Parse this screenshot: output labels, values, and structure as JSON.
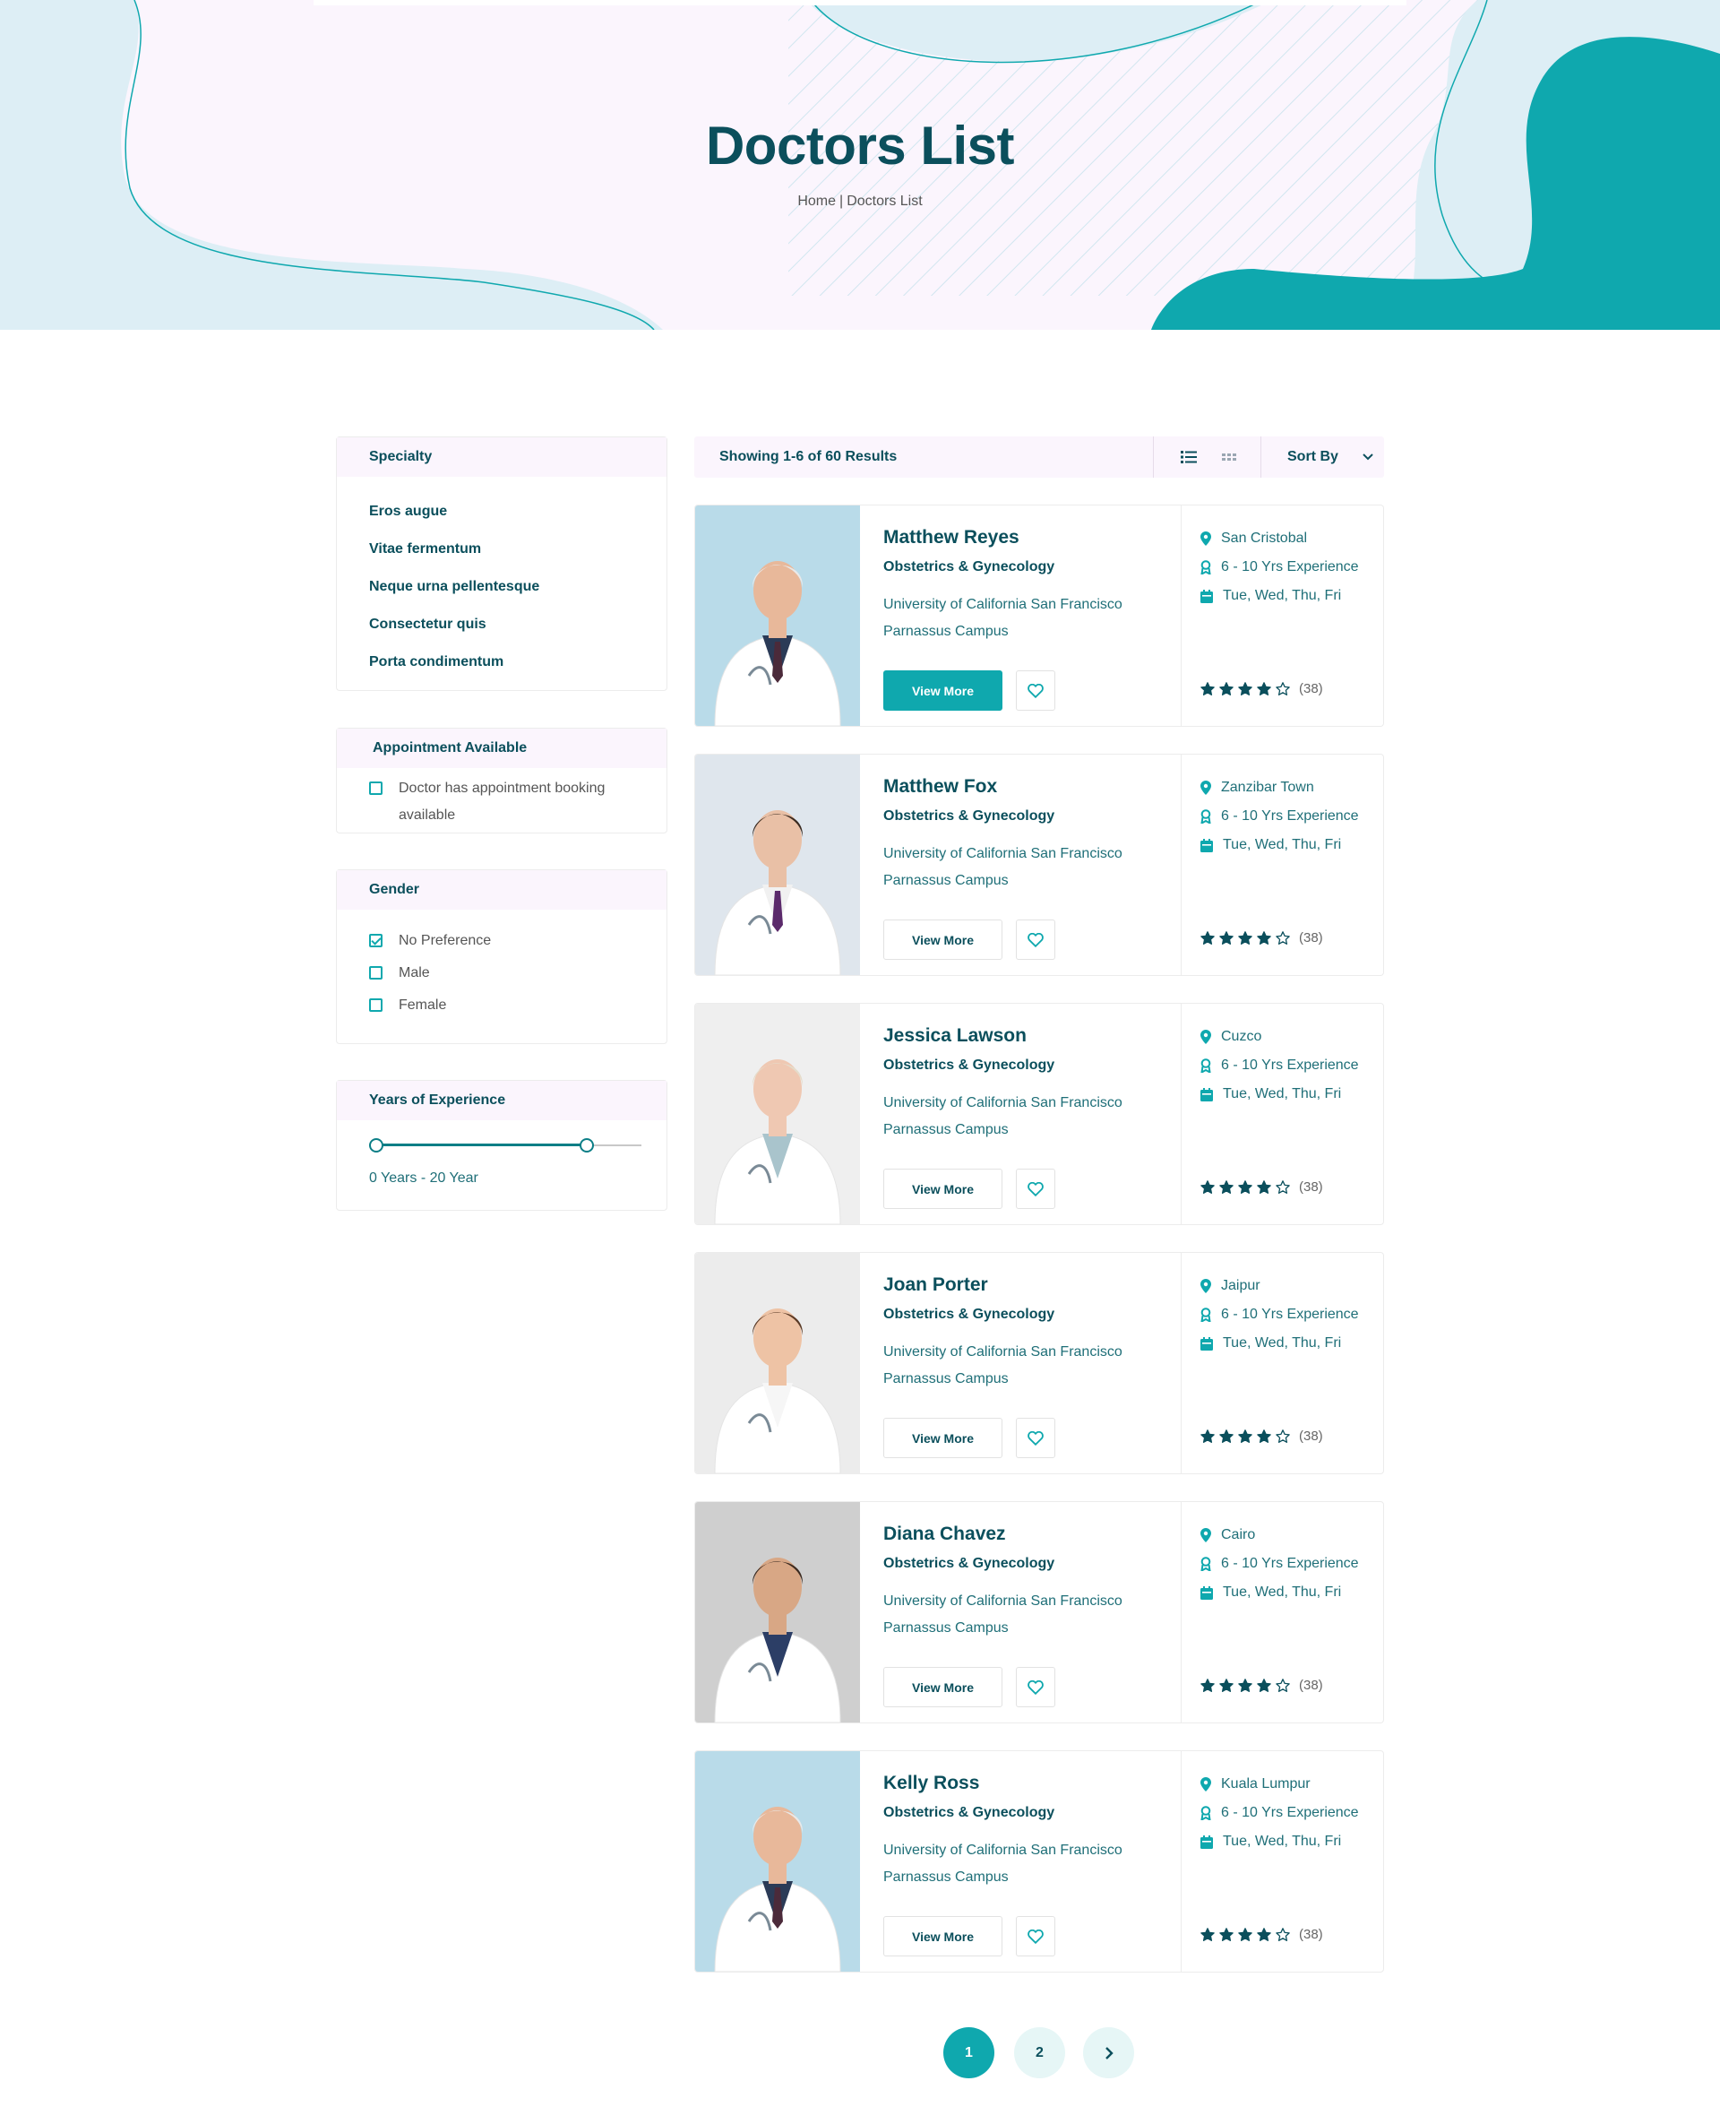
{
  "page": {
    "title": "Doctors List",
    "breadcrumb": {
      "home": "Home",
      "separator": "|",
      "current": "Doctors List"
    }
  },
  "colors": {
    "accent": "#0fa8ae",
    "dark": "#0b4f5c",
    "hero_bg": "#fbf5fd",
    "blob": "#ddeef5"
  },
  "sidebar": {
    "specialty": {
      "title": "Specialty",
      "items": [
        "Eros augue",
        "Vitae fermentum",
        "Neque urna pellentesque",
        "Consectetur quis",
        "Porta condimentum"
      ]
    },
    "appointment": {
      "title": "Appointment Available",
      "option": "Doctor has appointment booking available",
      "checked": false
    },
    "gender": {
      "title": "Gender",
      "options": [
        {
          "label": "No Preference",
          "checked": true
        },
        {
          "label": "Male",
          "checked": false
        },
        {
          "label": "Female",
          "checked": false
        }
      ]
    },
    "experience": {
      "title": "Years of Experience",
      "range_label": "0 Years - 20 Year",
      "slider_min_fraction": 0.0,
      "slider_max_fraction": 0.8
    }
  },
  "results": {
    "count_text": "Showing 1-6 of 60 Results",
    "view_icons": [
      "list-view-icon",
      "grid-view-icon"
    ],
    "sort_label": "Sort By"
  },
  "doctors": [
    {
      "name": "Matthew Reyes",
      "specialty": "Obstetrics & Gynecology",
      "university": "University of California San Francisco Parnassus Campus",
      "location": "San Cristobal",
      "experience": "6 - 10 Yrs Experience",
      "days": "Tue, Wed, Thu, Fri",
      "rating": 4,
      "reviews": "(38)",
      "button": "View More",
      "photo": "senior-male-doctor-ok-gesture"
    },
    {
      "name": "Matthew Fox",
      "specialty": "Obstetrics & Gynecology",
      "university": "University of California San Francisco Parnassus Campus",
      "location": "Zanzibar Town",
      "experience": "6 - 10 Yrs Experience",
      "days": "Tue, Wed, Thu, Fri",
      "rating": 4,
      "reviews": "(38)",
      "button": "View More",
      "photo": "female-doctor-with-tablet"
    },
    {
      "name": "Jessica Lawson",
      "specialty": "Obstetrics & Gynecology",
      "university": "University of California San Francisco Parnassus Campus",
      "location": "Cuzco",
      "experience": "6 - 10 Yrs Experience",
      "days": "Tue, Wed, Thu, Fri",
      "rating": 4,
      "reviews": "(38)",
      "button": "View More",
      "photo": "senior-female-doctor-arms-crossed"
    },
    {
      "name": "Joan Porter",
      "specialty": "Obstetrics & Gynecology",
      "university": "University of California San Francisco Parnassus Campus",
      "location": "Jaipur",
      "experience": "6 - 10 Yrs Experience",
      "days": "Tue, Wed, Thu, Fri",
      "rating": 4,
      "reviews": "(38)",
      "button": "View More",
      "photo": "female-doctor-pointing"
    },
    {
      "name": "Diana Chavez",
      "specialty": "Obstetrics & Gynecology",
      "university": "University of California San Francisco Parnassus Campus",
      "location": "Cairo",
      "experience": "6 - 10 Yrs Experience",
      "days": "Tue, Wed, Thu, Fri",
      "rating": 4,
      "reviews": "(38)",
      "button": "View More",
      "photo": "bearded-male-doctor-arms-crossed"
    },
    {
      "name": "Kelly Ross",
      "specialty": "Obstetrics & Gynecology",
      "university": "University of California San Francisco Parnassus Campus",
      "location": "Kuala Lumpur",
      "experience": "6 - 10 Yrs Experience",
      "days": "Tue, Wed, Thu, Fri",
      "rating": 4,
      "reviews": "(38)",
      "button": "View More",
      "photo": "senior-male-doctor-ok-gesture"
    }
  ],
  "pagination": {
    "pages": [
      "1",
      "2"
    ],
    "active": "1",
    "next_icon": "chevron-right-icon"
  }
}
